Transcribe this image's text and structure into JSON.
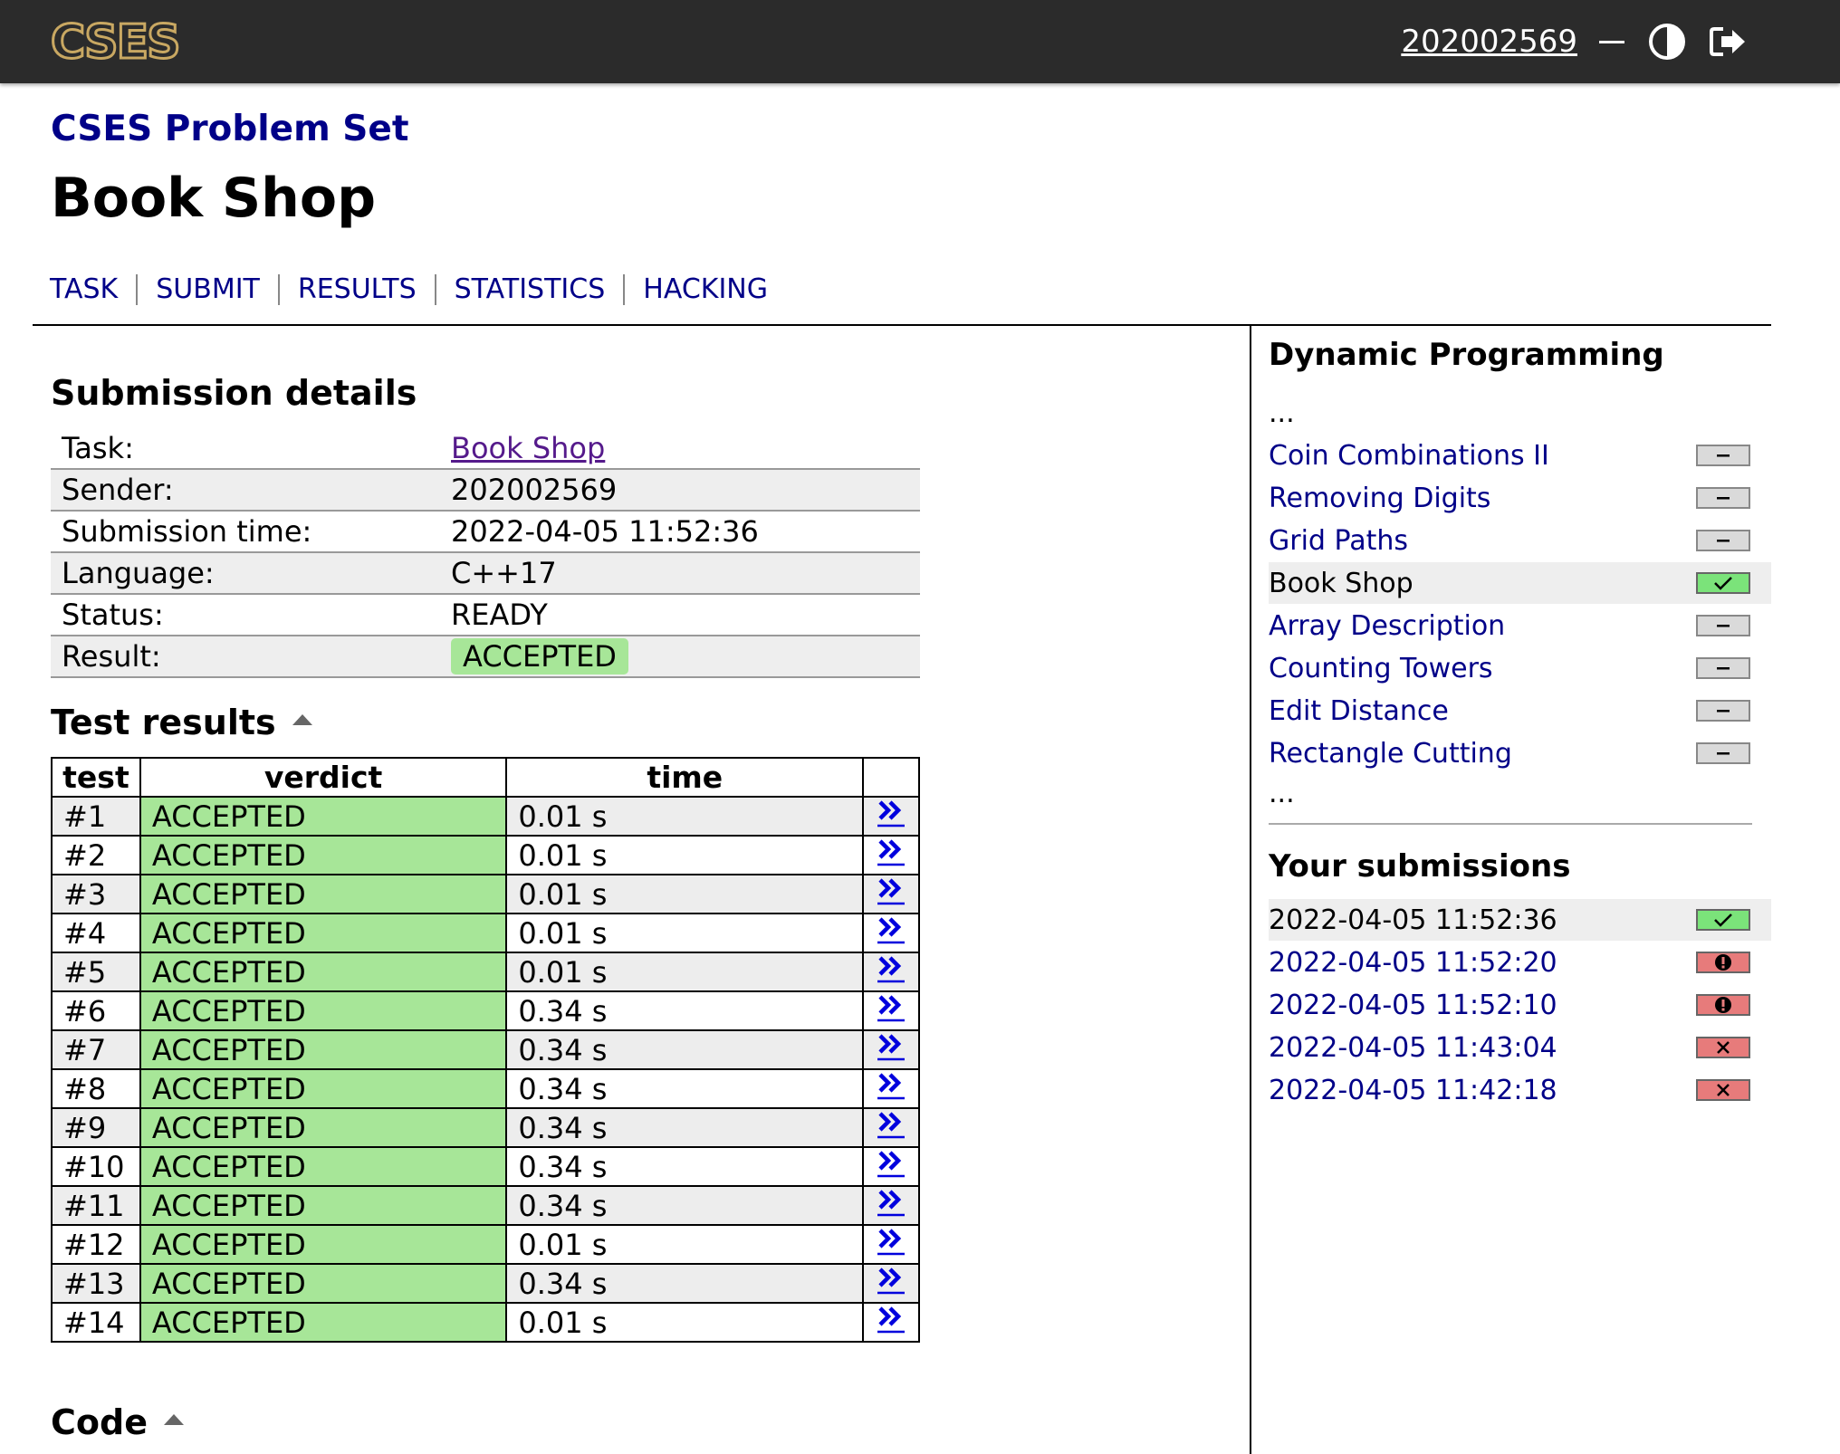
{
  "topbar": {
    "logo_text": "CSES",
    "username": "202002569",
    "theme_icon": "half-circle-icon",
    "logout_icon": "logout-icon"
  },
  "header": {
    "set_title": "CSES Problem Set",
    "page_title": "Book Shop",
    "nav": [
      "TASK",
      "SUBMIT",
      "RESULTS",
      "STATISTICS",
      "HACKING"
    ]
  },
  "submission": {
    "heading": "Submission details",
    "rows": [
      {
        "label": "Task:",
        "value": "Book Shop"
      },
      {
        "label": "Sender:",
        "value": "202002569"
      },
      {
        "label": "Submission time:",
        "value": "2022-04-05 11:52:36"
      },
      {
        "label": "Language:",
        "value": "C++17"
      },
      {
        "label": "Status:",
        "value": "READY"
      },
      {
        "label": "Result:",
        "value": "ACCEPTED"
      }
    ]
  },
  "tests": {
    "heading": "Test results",
    "columns": [
      "test",
      "verdict",
      "time",
      ""
    ],
    "rows": [
      {
        "test": "#1",
        "verdict": "ACCEPTED",
        "time": "0.01 s"
      },
      {
        "test": "#2",
        "verdict": "ACCEPTED",
        "time": "0.01 s"
      },
      {
        "test": "#3",
        "verdict": "ACCEPTED",
        "time": "0.01 s"
      },
      {
        "test": "#4",
        "verdict": "ACCEPTED",
        "time": "0.01 s"
      },
      {
        "test": "#5",
        "verdict": "ACCEPTED",
        "time": "0.01 s"
      },
      {
        "test": "#6",
        "verdict": "ACCEPTED",
        "time": "0.34 s"
      },
      {
        "test": "#7",
        "verdict": "ACCEPTED",
        "time": "0.34 s"
      },
      {
        "test": "#8",
        "verdict": "ACCEPTED",
        "time": "0.34 s"
      },
      {
        "test": "#9",
        "verdict": "ACCEPTED",
        "time": "0.34 s"
      },
      {
        "test": "#10",
        "verdict": "ACCEPTED",
        "time": "0.34 s"
      },
      {
        "test": "#11",
        "verdict": "ACCEPTED",
        "time": "0.34 s"
      },
      {
        "test": "#12",
        "verdict": "ACCEPTED",
        "time": "0.01 s"
      },
      {
        "test": "#13",
        "verdict": "ACCEPTED",
        "time": "0.34 s"
      },
      {
        "test": "#14",
        "verdict": "ACCEPTED",
        "time": "0.01 s"
      }
    ]
  },
  "code": {
    "heading": "Code"
  },
  "sidebar": {
    "category_heading": "Dynamic Programming",
    "ellipsis": "...",
    "tasks": [
      {
        "label": "Coin Combinations II",
        "status": "none"
      },
      {
        "label": "Removing Digits",
        "status": "none"
      },
      {
        "label": "Grid Paths",
        "status": "none"
      },
      {
        "label": "Book Shop",
        "status": "ok"
      },
      {
        "label": "Array Description",
        "status": "none"
      },
      {
        "label": "Counting Towers",
        "status": "none"
      },
      {
        "label": "Edit Distance",
        "status": "none"
      },
      {
        "label": "Rectangle Cutting",
        "status": "none"
      }
    ],
    "submissions_heading": "Your submissions",
    "submissions": [
      {
        "time": "2022-04-05 11:52:36",
        "status": "ok"
      },
      {
        "time": "2022-04-05 11:52:20",
        "status": "error"
      },
      {
        "time": "2022-04-05 11:52:10",
        "status": "error"
      },
      {
        "time": "2022-04-05 11:43:04",
        "status": "wrong"
      },
      {
        "time": "2022-04-05 11:42:18",
        "status": "wrong"
      }
    ]
  },
  "colors": {
    "topbar": "#2b2b2b",
    "link": "#000088",
    "accepted": "#a7e698",
    "ok_badge": "#7be37a",
    "err_badge": "#e77b7b"
  }
}
